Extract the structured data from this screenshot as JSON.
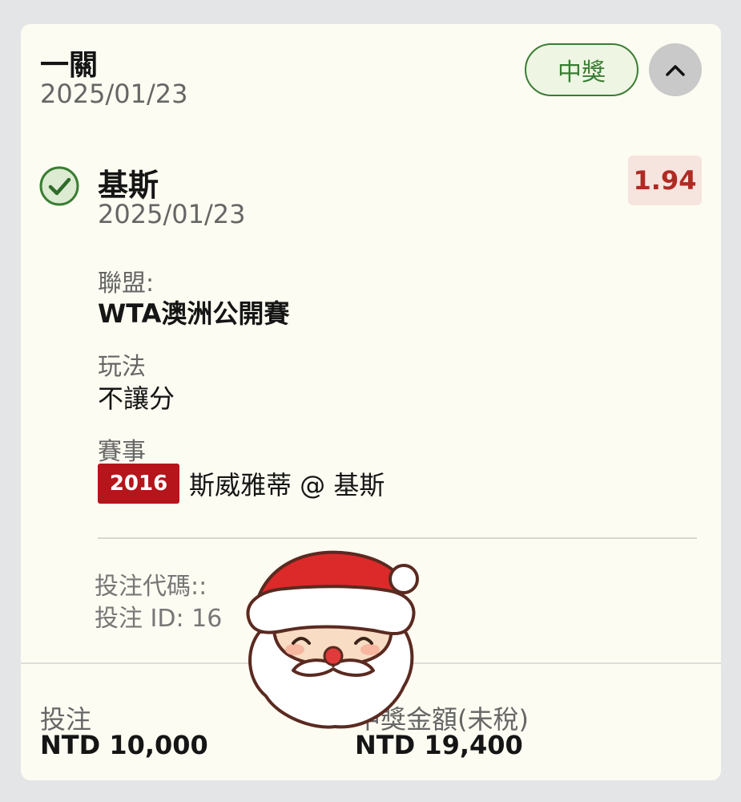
{
  "bet": {
    "type": "一關",
    "date": "2025/01/23",
    "status": "中獎"
  },
  "selection": {
    "name": "基斯",
    "date": "2025/01/23",
    "odds": "1.94",
    "league_label": "聯盟:",
    "league_value": "WTA澳洲公開賽",
    "market_label": "玩法",
    "market_value": "不讓分",
    "event_label": "賽事",
    "event_number": "2016",
    "event_teams": "斯威雅蒂 @ 基斯"
  },
  "codes": {
    "bet_code": "投注代碼::",
    "bet_id": "投注 ID: 16"
  },
  "footer": {
    "stake_label": "投注",
    "stake_value": "NTD 10,000",
    "payout_label": "中獎金額(未稅)",
    "payout_value": "NTD 19,400"
  },
  "colors": {
    "win_green": "#3a7d34",
    "odds_red": "#b02a24",
    "event_badge_red": "#b5151b",
    "card_background": "#fdfcf2"
  },
  "icons": {
    "check": "check-circle-icon",
    "collapse": "chevron-up-icon",
    "sticker": "santa-sticker"
  }
}
